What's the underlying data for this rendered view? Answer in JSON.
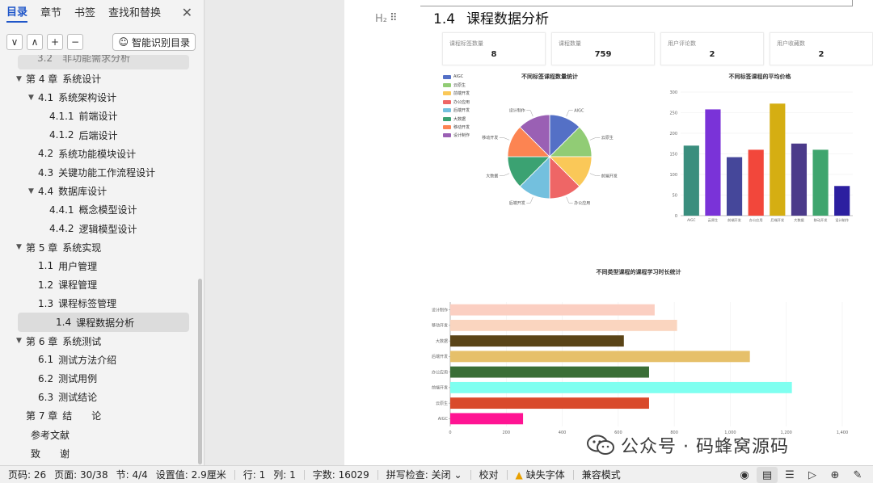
{
  "nav": {
    "tabs": [
      "目录",
      "章节",
      "书签",
      "查找和替换"
    ],
    "close_icon": "close-icon",
    "tools": [
      "∨",
      "∧",
      "+",
      "−"
    ],
    "smart_toc": "智能识别目录",
    "partial_item": "3.2　非功能需求分析",
    "toc": [
      {
        "num": "第 4 章",
        "text": "系统设计",
        "level": 1,
        "arrow": true
      },
      {
        "num": "4.1",
        "text": "系统架构设计",
        "level": 2,
        "arrow": true
      },
      {
        "num": "4.1.1",
        "text": "前端设计",
        "level": 3,
        "arrow": false
      },
      {
        "num": "4.1.2",
        "text": "后端设计",
        "level": 3,
        "arrow": false
      },
      {
        "num": "4.2",
        "text": "系统功能模块设计",
        "level": 2,
        "arrow": false
      },
      {
        "num": "4.3",
        "text": "关键功能工作流程设计",
        "level": 2,
        "arrow": false
      },
      {
        "num": "4.4",
        "text": "数据库设计",
        "level": 2,
        "arrow": true
      },
      {
        "num": "4.4.1",
        "text": "概念模型设计",
        "level": 3,
        "arrow": false
      },
      {
        "num": "4.4.2",
        "text": "逻辑模型设计",
        "level": 3,
        "arrow": false
      },
      {
        "num": "第 5 章",
        "text": "系统实现",
        "level": 1,
        "arrow": true
      },
      {
        "num": "1.1",
        "text": "用户管理",
        "level": 2,
        "arrow": false
      },
      {
        "num": "1.2",
        "text": "课程管理",
        "level": 2,
        "arrow": false
      },
      {
        "num": "1.3",
        "text": "课程标签管理",
        "level": 2,
        "arrow": false
      },
      {
        "num": "1.4",
        "text": "课程数据分析",
        "level": 2,
        "arrow": false,
        "selected": true
      },
      {
        "num": "第 6 章",
        "text": "系统测试",
        "level": 1,
        "arrow": true
      },
      {
        "num": "6.1",
        "text": "测试方法介绍",
        "level": 2,
        "arrow": false
      },
      {
        "num": "6.2",
        "text": "测试用例",
        "level": 2,
        "arrow": false
      },
      {
        "num": "6.3",
        "text": "测试结论",
        "level": 2,
        "arrow": false
      },
      {
        "num": "第 7 章",
        "text": "结　　论",
        "level": 1,
        "arrow": false
      },
      {
        "num": "",
        "text": "参考文献",
        "level": 1,
        "arrow": false
      },
      {
        "num": "",
        "text": "致　　谢",
        "level": 1,
        "arrow": false
      }
    ]
  },
  "doc": {
    "heading_marker": "H₂",
    "heading_num": "1.4",
    "heading_text": "课程数据分析",
    "stats": [
      {
        "label": "课程标签数量",
        "value": "8"
      },
      {
        "label": "课程数量",
        "value": "759"
      },
      {
        "label": "用户评论数",
        "value": "2"
      },
      {
        "label": "用户收藏数",
        "value": "2"
      }
    ],
    "watermark": "公众号 · 码蜂窝源码"
  },
  "chart_data": [
    {
      "type": "pie",
      "title": "不同标签课程数量统计",
      "legend": "top-left",
      "categories": [
        "AIGC",
        "云原生",
        "前端开发",
        "办公应用",
        "后端开发",
        "大数据",
        "移动开发",
        "设计制作"
      ],
      "values": [
        1,
        1,
        1,
        1,
        1,
        1,
        1,
        1
      ],
      "colors": [
        "#5470c6",
        "#91cc75",
        "#fac858",
        "#ee6666",
        "#73c0de",
        "#3ba272",
        "#fc8452",
        "#9a60b4"
      ]
    },
    {
      "type": "bar",
      "title": "不同标签课程的平均价格",
      "categories": [
        "AIGC",
        "云原生",
        "前端开发",
        "办公应用",
        "后端开发",
        "大数据",
        "移动开发",
        "设计制作"
      ],
      "values": [
        170,
        258,
        142,
        160,
        272,
        175,
        160,
        72
      ],
      "colors": [
        "#3a8e7e",
        "#7a33d8",
        "#45479a",
        "#f2473b",
        "#d5ae12",
        "#4b3a8a",
        "#3fa56e",
        "#2c1fa0"
      ],
      "ylim": [
        0,
        300
      ],
      "yticks": [
        0,
        50,
        100,
        150,
        200,
        250,
        300
      ],
      "grid": true
    },
    {
      "type": "bar",
      "orientation": "horizontal",
      "title": "不同类型课程的课程学习时长统计",
      "categories": [
        "AIGC",
        "云原生",
        "前端开发",
        "办公应用",
        "后端开发",
        "大数据",
        "移动开发",
        "设计制作"
      ],
      "values": [
        260,
        710,
        1220,
        710,
        1070,
        620,
        810,
        730
      ],
      "colors": [
        "#ff1493",
        "#d94a2b",
        "#7ffff0",
        "#3a6e36",
        "#e6c06a",
        "#5a4417",
        "#fad5bf",
        "#fbcfc2"
      ],
      "xlim": [
        0,
        1400
      ],
      "xticks": [
        "0",
        "200",
        "400",
        "600",
        "800",
        "1,000",
        "1,200",
        "1,400"
      ],
      "grid": true
    }
  ],
  "status": {
    "page": "页码: 26",
    "pages": "页面: 30/38",
    "section": "节: 4/4",
    "setting": "设置值: 2.9厘米",
    "row": "行: 1",
    "col": "列: 1",
    "words": "字数: 16029",
    "spell": "拼写检查: 关闭",
    "proof": "校对",
    "missing_font": "缺失字体",
    "compat": "兼容模式"
  }
}
